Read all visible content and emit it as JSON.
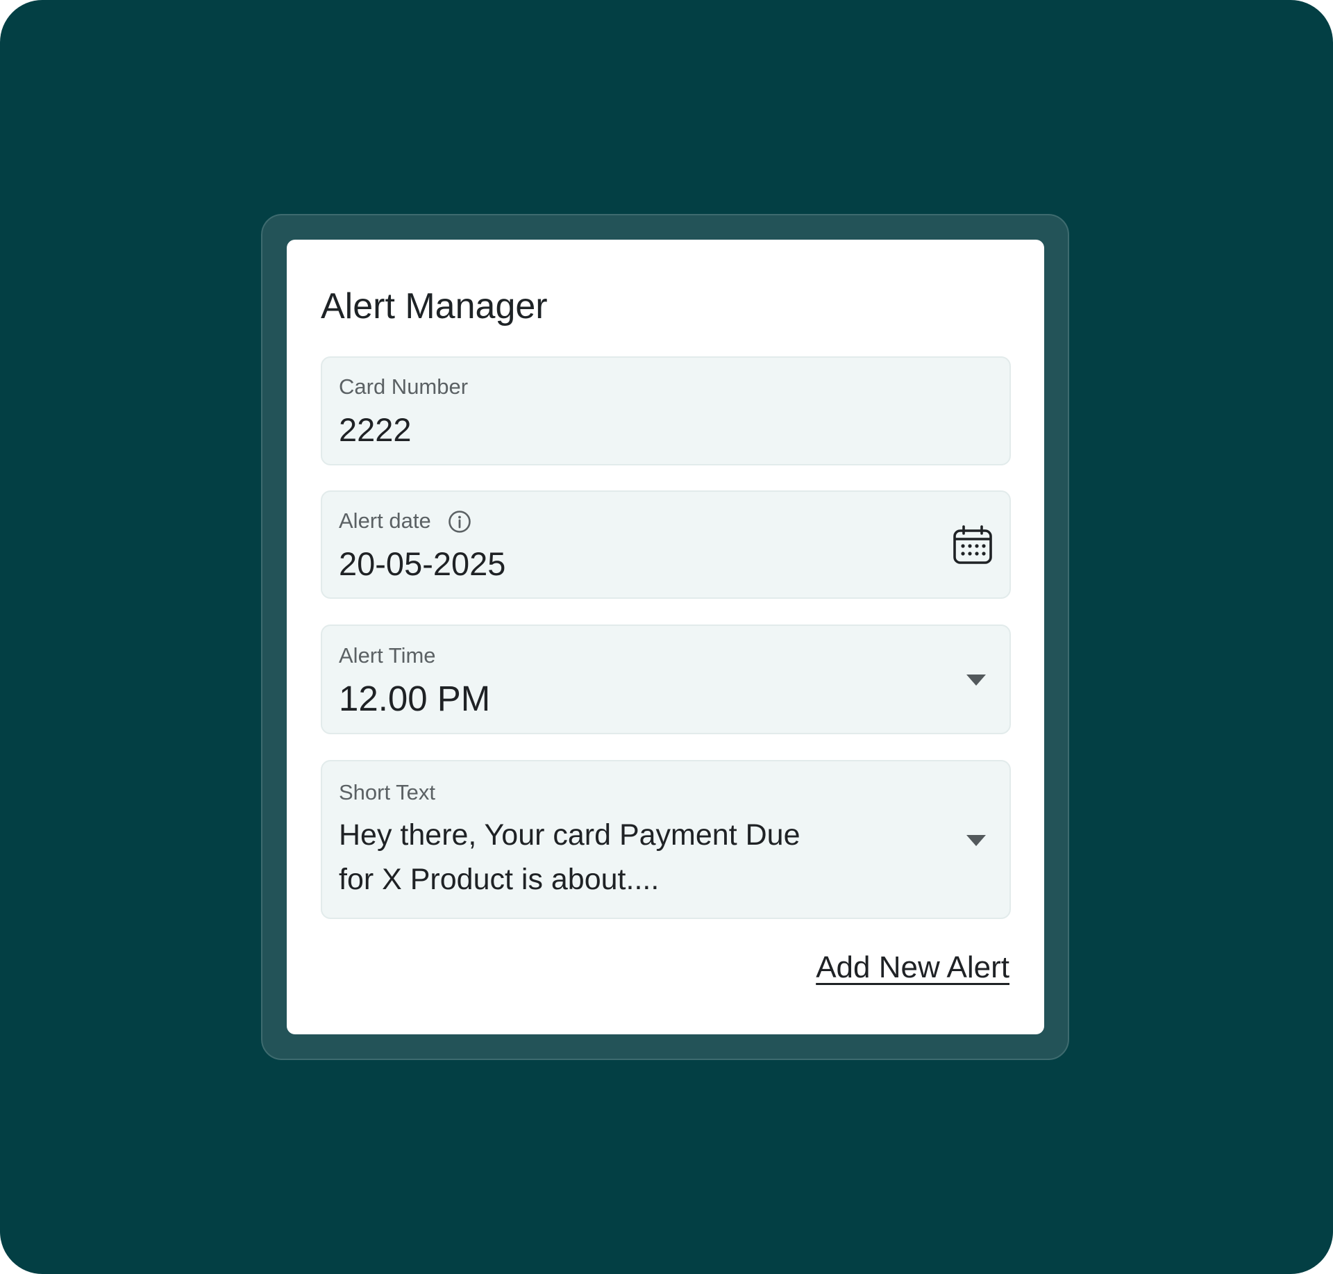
{
  "title": "Alert Manager",
  "fields": {
    "card_number": {
      "label": "Card Number",
      "value": "2222"
    },
    "alert_date": {
      "label": "Alert date",
      "value": "20-05-2025",
      "icons": [
        "info-icon",
        "calendar-icon"
      ]
    },
    "alert_time": {
      "label": "Alert Time",
      "value": "12.00 PM",
      "icon": "dropdown-arrow-icon"
    },
    "short_text": {
      "label": "Short Text",
      "value": "Hey there, Your card Payment Due for X Product is about....",
      "icon": "dropdown-arrow-icon"
    }
  },
  "actions": {
    "add_new_alert": "Add New Alert"
  },
  "colors": {
    "background": "#033f44",
    "frame": "#235358",
    "card": "#ffffff",
    "field_background": "#f0f6f6",
    "text": "#1f2225",
    "label": "#5b6164"
  }
}
